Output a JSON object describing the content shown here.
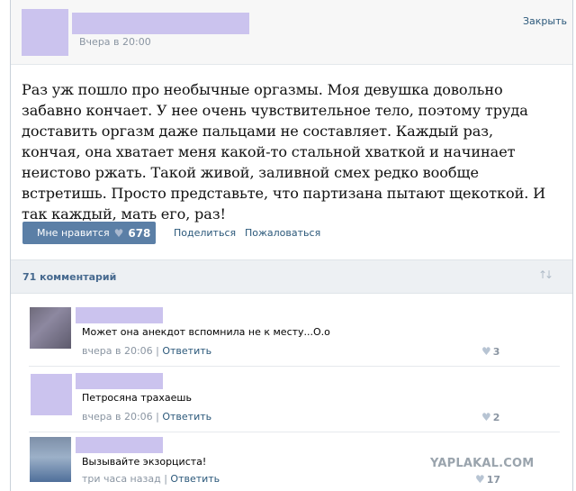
{
  "post": {
    "time": "Вчера в 20:00",
    "close_label": "Закрыть",
    "text": "Раз уж пошло про необычные оргазмы. Моя девушка довольно забавно кончает. У нее очень чувствительное тело, поэтому труда доставить оргазм даже пальцами не составляет. Каждый раз, кончая, она хватает меня какой-то стальной хваткой и начинает неистово ржать. Такой живой, заливной смех редко вообще встретишь. Просто представьте, что партизана пытают щекоткой. И так каждый, мать его, раз!",
    "like_label": "Мне нравится",
    "like_count": "678",
    "share_label": "Поделиться",
    "report_label": "Пожаловаться"
  },
  "comments_header": {
    "count_label": "71 комментарий"
  },
  "comments": [
    {
      "text": "Может она анекдот вспомнила не к месту...О.о",
      "time": "вчера в 20:06",
      "reply": "Ответить",
      "likes": "3"
    },
    {
      "text": "Петросяна трахаешь",
      "time": "вчера в 20:06",
      "reply": "Ответить",
      "likes": "2"
    },
    {
      "text": "Вызывайте экзорциста!",
      "time": "три часа назад",
      "reply": "Ответить",
      "likes": "17"
    }
  ],
  "watermark": "YAPLAKAL.COM",
  "colors": {
    "redacted": "#cbc3ee",
    "link": "#2b587a",
    "button": "#5b7fa6"
  }
}
